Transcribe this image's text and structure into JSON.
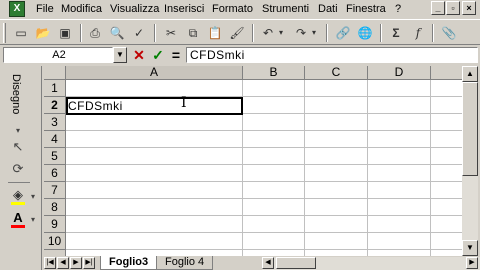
{
  "menubar": {
    "items": [
      "File",
      "Modifica",
      "Visualizza",
      "Inserisci",
      "Formato",
      "Strumenti",
      "Dati",
      "Finestra",
      "?"
    ],
    "window_controls": [
      "_",
      "▫",
      "×"
    ]
  },
  "toolbar": {
    "buttons": [
      "new-doc-icon",
      "open-folder-icon",
      "save-icon",
      "print-icon",
      "print-preview-icon",
      "spelling-icon",
      "cut-icon",
      "copy-icon",
      "paste-icon",
      "format-painter-icon",
      "undo-icon",
      "redo-icon",
      "hyperlink-icon",
      "web-icon",
      "autosum-icon",
      "function-icon",
      "assistant-icon"
    ]
  },
  "formula_bar": {
    "name_box": "A2",
    "cancel_symbol": "✕",
    "enter_symbol": "✓",
    "equals_symbol": "=",
    "content": "CFDSmki"
  },
  "drawing_bar": {
    "title": "Disegno"
  },
  "sheet": {
    "columns": [
      "A",
      "B",
      "C",
      "D"
    ],
    "rows": [
      "1",
      "2",
      "3",
      "4",
      "5",
      "6",
      "7",
      "8",
      "9",
      "10"
    ],
    "active_cell": "A2",
    "active_cell_value": "CFDSmki",
    "cursor": "I"
  },
  "tabs": {
    "items": [
      "Foglio3",
      "Foglio 4"
    ],
    "active": "Foglio3"
  }
}
